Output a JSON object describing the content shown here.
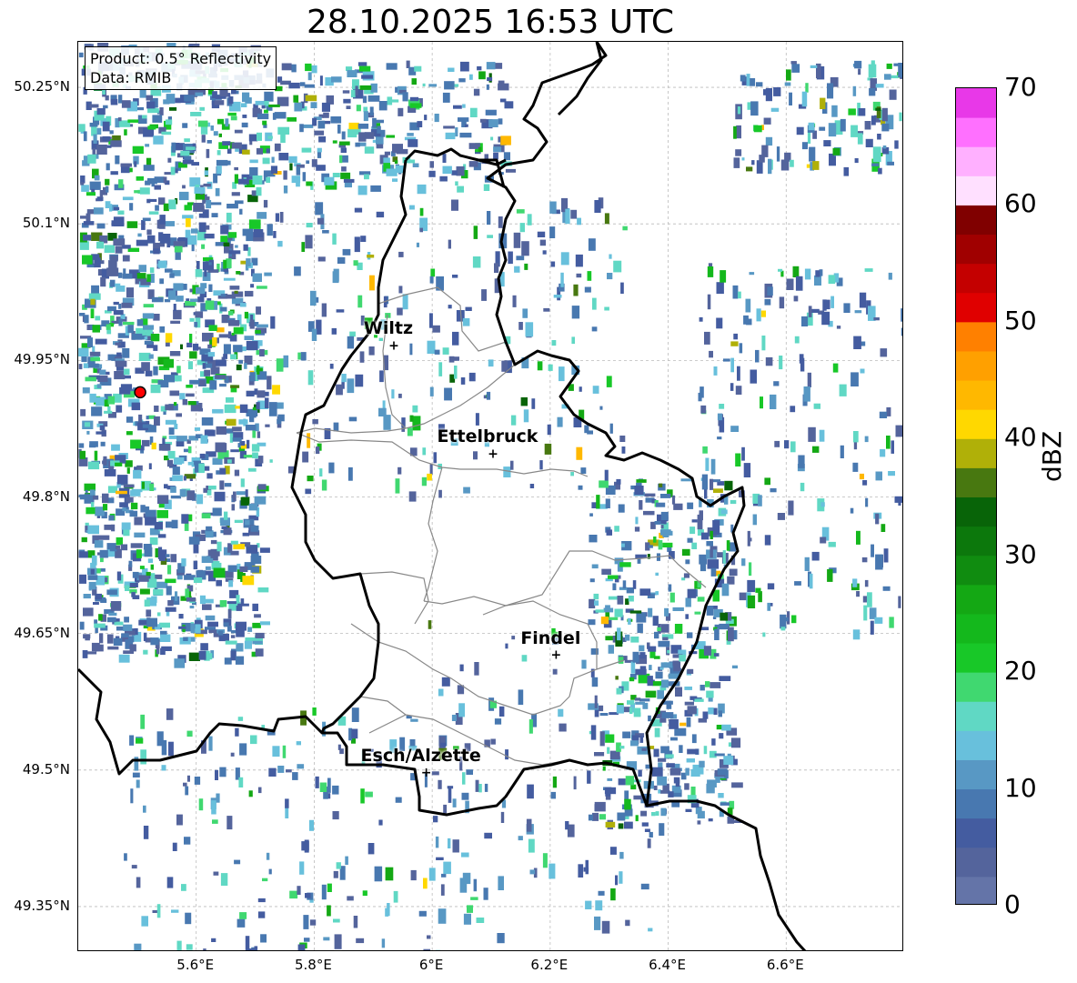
{
  "title": "28.10.2025 16:53 UTC",
  "info_box": {
    "product": "Product: 0.5° Reflectivity",
    "data": "Data: RMIB"
  },
  "lat_ticks": [
    {
      "value": 50.25,
      "label": "50.25°N"
    },
    {
      "value": 50.1,
      "label": "50.1°N"
    },
    {
      "value": 49.95,
      "label": "49.95°N"
    },
    {
      "value": 49.8,
      "label": "49.8°N"
    },
    {
      "value": 49.65,
      "label": "49.65°N"
    },
    {
      "value": 49.5,
      "label": "49.5°N"
    },
    {
      "value": 49.35,
      "label": "49.35°N"
    }
  ],
  "lon_ticks": [
    {
      "value": 5.6,
      "label": "5.6°E"
    },
    {
      "value": 5.8,
      "label": "5.8°E"
    },
    {
      "value": 6.0,
      "label": "6°E"
    },
    {
      "value": 6.2,
      "label": "6.2°E"
    },
    {
      "value": 6.4,
      "label": "6.4°E"
    },
    {
      "value": 6.6,
      "label": "6.6°E"
    }
  ],
  "extent": {
    "lon_min": 5.4,
    "lon_max": 6.8,
    "lat_min": 49.3,
    "lat_max": 50.3
  },
  "cities": [
    {
      "name": "Wiltz",
      "lon": 5.935,
      "lat": 49.967
    },
    {
      "name": "Ettelbruck",
      "lon": 6.103,
      "lat": 49.848
    },
    {
      "name": "Findel",
      "lon": 6.21,
      "lat": 49.627
    },
    {
      "name": "Esch/Alzette",
      "lon": 5.99,
      "lat": 49.498
    }
  ],
  "radar_site": {
    "lon": 5.505,
    "lat": 49.915,
    "color": "#ff0000"
  },
  "colorbar": {
    "label": "dBZ",
    "min": 0,
    "max": 70,
    "ticks": [
      "0",
      "10",
      "20",
      "30",
      "40",
      "50",
      "60",
      "70"
    ],
    "colors": [
      "#6474a8",
      "#54649c",
      "#445ca0",
      "#4878b0",
      "#5898c4",
      "#68c0dc",
      "#60d8c4",
      "#40d870",
      "#18c828",
      "#14b81c",
      "#14a814",
      "#108c10",
      "#0c780c",
      "#086408",
      "#487810",
      "#b0b008",
      "#ffd800",
      "#ffb800",
      "#ffa000",
      "#ff8000",
      "#e00000",
      "#c40000",
      "#a00000",
      "#800000",
      "#ffe0ff",
      "#ffb0ff",
      "#ff70ff",
      "#e838e8"
    ]
  },
  "colors": {
    "country_border": "#000000",
    "canton_border": "#888888",
    "gridline": "#bbbbbb"
  }
}
